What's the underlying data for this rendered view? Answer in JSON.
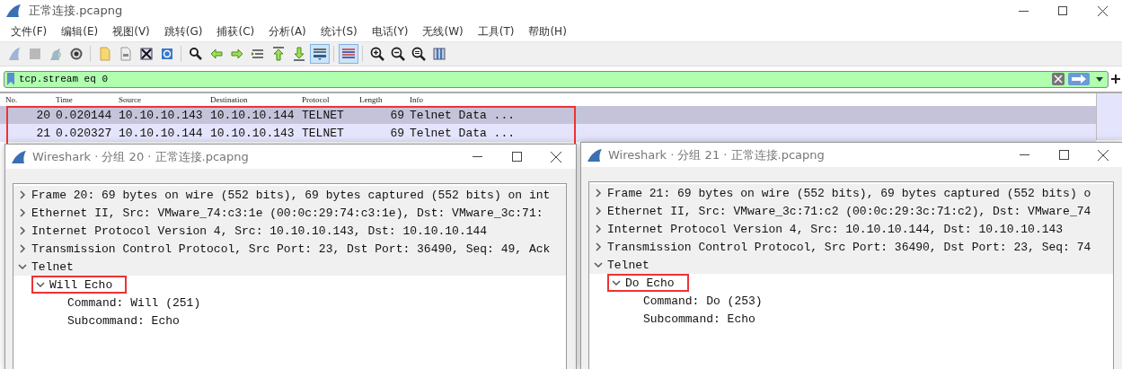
{
  "window": {
    "title": "正常连接.pcapng"
  },
  "menu": [
    "文件(F)",
    "编辑(E)",
    "视图(V)",
    "跳转(G)",
    "捕获(C)",
    "分析(A)",
    "统计(S)",
    "电话(Y)",
    "无线(W)",
    "工具(T)",
    "帮助(H)"
  ],
  "toolbar": [
    [
      {
        "kind": "fin",
        "pressed": false,
        "disabled": true
      },
      {
        "kind": "stop",
        "pressed": false,
        "disabled": true
      },
      {
        "kind": "restart",
        "pressed": false,
        "disabled": true
      },
      {
        "kind": "options",
        "pressed": false,
        "disabled": false
      }
    ],
    [
      {
        "kind": "open",
        "pressed": false,
        "disabled": false
      },
      {
        "kind": "file",
        "pressed": false,
        "disabled": false
      },
      {
        "kind": "close",
        "pressed": false,
        "disabled": false
      },
      {
        "kind": "reload",
        "pressed": false,
        "disabled": false
      }
    ],
    [
      {
        "kind": "find",
        "pressed": false,
        "disabled": false
      },
      {
        "kind": "back",
        "pressed": false,
        "disabled": false
      },
      {
        "kind": "forward",
        "pressed": false,
        "disabled": false
      },
      {
        "kind": "goto",
        "pressed": false,
        "disabled": false
      },
      {
        "kind": "first",
        "pressed": false,
        "disabled": false
      },
      {
        "kind": "last",
        "pressed": false,
        "disabled": false
      },
      {
        "kind": "autoscroll",
        "pressed": true,
        "disabled": false
      }
    ],
    [
      {
        "kind": "colorize",
        "pressed": true,
        "disabled": false
      }
    ],
    [
      {
        "kind": "zoomin",
        "pressed": false,
        "disabled": false
      },
      {
        "kind": "zoomout",
        "pressed": false,
        "disabled": false
      },
      {
        "kind": "zoomreset",
        "pressed": false,
        "disabled": false
      },
      {
        "kind": "resize",
        "pressed": false,
        "disabled": false
      }
    ]
  ],
  "filter": {
    "value": "tcp.stream eq 0"
  },
  "packet_list": {
    "highlighted": true,
    "columns": [
      "No.",
      "Time",
      "Source",
      "Destination",
      "Protocol",
      "Length",
      "Info"
    ],
    "rows": [
      {
        "selected": true,
        "cells": [
          "20",
          "0.020144",
          "10.10.10.143",
          "10.10.10.144",
          "TELNET",
          "69",
          "Telnet Data ..."
        ]
      },
      {
        "selected": false,
        "cells": [
          "21",
          "0.020327",
          "10.10.10.144",
          "10.10.10.143",
          "TELNET",
          "69",
          "Telnet Data ..."
        ]
      }
    ]
  },
  "detail_windows": [
    {
      "title": "Wireshark · 分组 20 · 正常连接.pcapng",
      "tree": [
        {
          "label": "Frame 20: 69 bytes on wire (552 bits), 69 bytes captured (552 bits) on int",
          "expanded": false,
          "shaded": true,
          "highlighted": false
        },
        {
          "label": "Ethernet II, Src: VMware_74:c3:1e (00:0c:29:74:c3:1e), Dst: VMware_3c:71:",
          "expanded": false,
          "shaded": true,
          "highlighted": false
        },
        {
          "label": "Internet Protocol Version 4, Src: 10.10.10.143, Dst: 10.10.10.144",
          "expanded": false,
          "shaded": true,
          "highlighted": false
        },
        {
          "label": "Transmission Control Protocol, Src Port: 23, Dst Port: 36490, Seq: 49, Ack",
          "expanded": false,
          "shaded": true,
          "highlighted": false
        },
        {
          "label": "Telnet",
          "expanded": true,
          "shaded": true,
          "highlighted": false,
          "children": [
            {
              "label": "Will Echo",
              "expanded": true,
              "shaded": false,
              "highlighted": true,
              "children": [
                {
                  "label": "Command: Will (251)",
                  "shaded": false,
                  "highlighted": false
                },
                {
                  "label": "Subcommand: Echo",
                  "shaded": false,
                  "highlighted": false
                }
              ]
            }
          ]
        }
      ]
    },
    {
      "title": "Wireshark · 分组 21 · 正常连接.pcapng",
      "tree": [
        {
          "label": "Frame 21: 69 bytes on wire (552 bits), 69 bytes captured (552 bits) o",
          "expanded": false,
          "shaded": true,
          "highlighted": false
        },
        {
          "label": "Ethernet II, Src: VMware_3c:71:c2 (00:0c:29:3c:71:c2), Dst: VMware_74",
          "expanded": false,
          "shaded": true,
          "highlighted": false
        },
        {
          "label": "Internet Protocol Version 4, Src: 10.10.10.144, Dst: 10.10.10.143",
          "expanded": false,
          "shaded": true,
          "highlighted": false
        },
        {
          "label": "Transmission Control Protocol, Src Port: 36490, Dst Port: 23, Seq: 74",
          "expanded": false,
          "shaded": true,
          "highlighted": false
        },
        {
          "label": "Telnet",
          "expanded": true,
          "shaded": true,
          "highlighted": false,
          "children": [
            {
              "label": "Do Echo",
              "expanded": true,
              "shaded": false,
              "highlighted": true,
              "children": [
                {
                  "label": "Command: Do (253)",
                  "shaded": false,
                  "highlighted": false
                },
                {
                  "label": "Subcommand: Echo",
                  "shaded": false,
                  "highlighted": false
                }
              ]
            }
          ]
        }
      ]
    }
  ]
}
